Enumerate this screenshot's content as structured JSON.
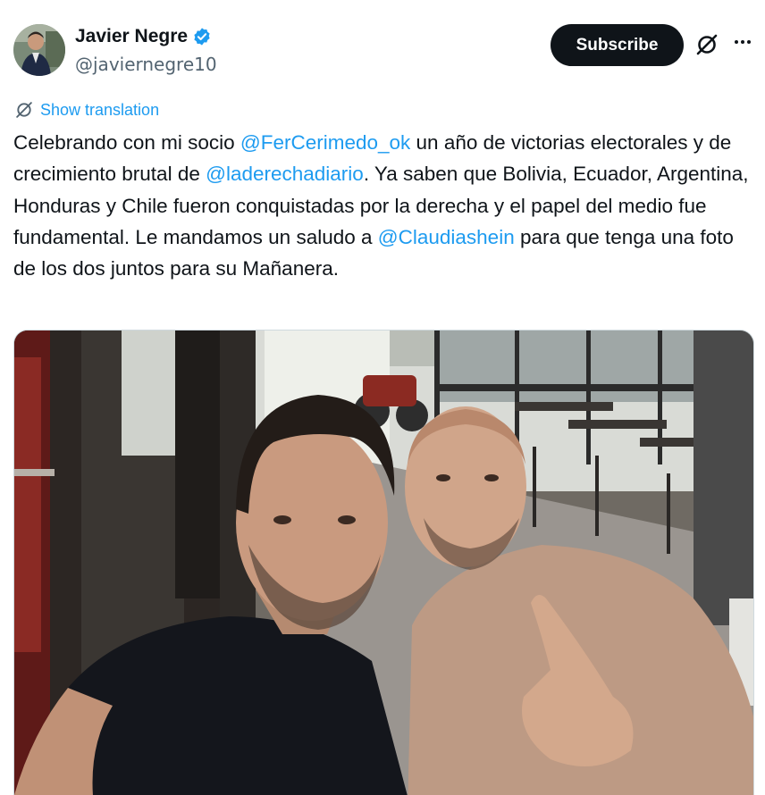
{
  "author": {
    "display_name": "Javier Negre",
    "handle": "@javiernegre10",
    "verified_icon": "verified-badge-icon",
    "avatar": "avatar"
  },
  "actions": {
    "subscribe_label": "Subscribe",
    "grok_icon": "grok-icon",
    "more_icon": "more-icon"
  },
  "translation": {
    "label": "Show translation",
    "icon": "translate-icon"
  },
  "tweet": {
    "t1": "Celebrando con mi socio ",
    "m1": "@FerCerimedo_ok",
    "t2": " un año de victorias electorales y de crecimiento brutal de ",
    "m2": "@laderechadiario",
    "t3": ". Ya saben que Bolivia, Ecuador, Argentina, Honduras y Chile fueron conquistadas por la derecha y el papel del medio fue fundamental. Le mandamos un saludo a ",
    "m3": "@Claudiashein",
    "t4": " para que tenga una foto de los dos juntos para su Mañanera."
  },
  "colors": {
    "accent": "#1d9bf0",
    "text": "#0f1419",
    "secondary": "#536471",
    "button": "#0f1419"
  }
}
